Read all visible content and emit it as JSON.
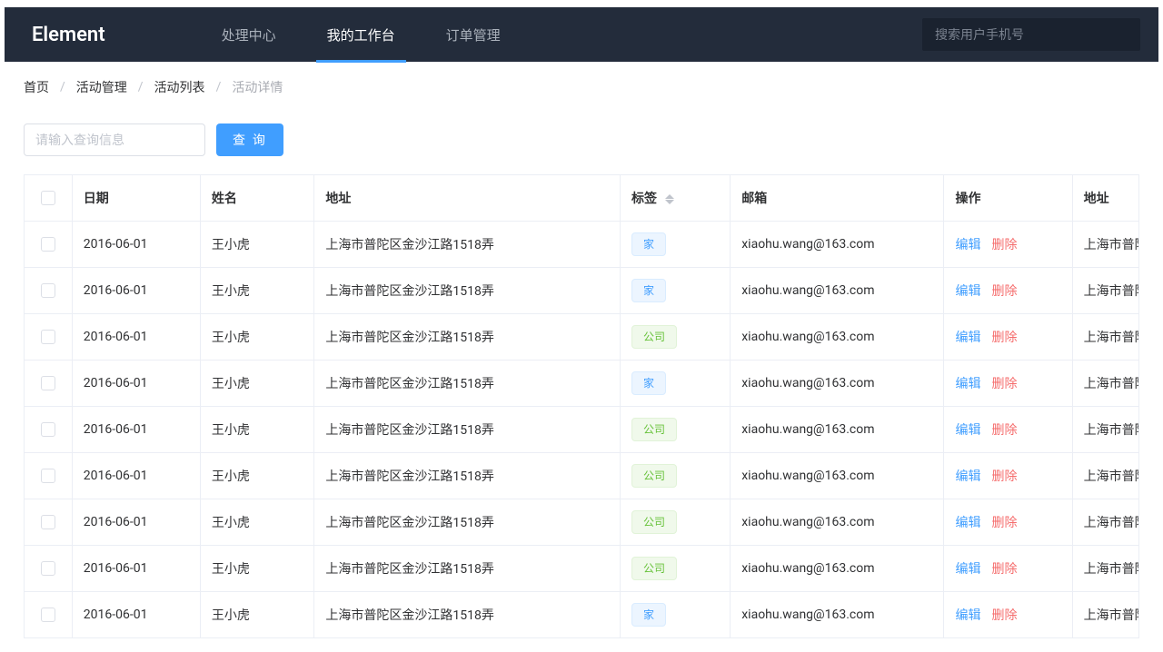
{
  "header": {
    "brand": "Element",
    "nav": [
      {
        "label": "处理中心",
        "active": false
      },
      {
        "label": "我的工作台",
        "active": true
      },
      {
        "label": "订单管理",
        "active": false
      }
    ],
    "search_placeholder": "搜索用户手机号"
  },
  "breadcrumb": {
    "items": [
      "首页",
      "活动管理",
      "活动列表"
    ],
    "current": "活动详情"
  },
  "toolbar": {
    "query_placeholder": "请输入查询信息",
    "query_btn": "查 询"
  },
  "table": {
    "columns": {
      "date": "日期",
      "name": "姓名",
      "address": "地址",
      "tag": "标签",
      "email": "邮箱",
      "operation": "操作",
      "address2": "地址"
    },
    "op_labels": {
      "edit": "编辑",
      "delete": "删除"
    },
    "tag_labels": {
      "home": "家",
      "company": "公司"
    },
    "rows": [
      {
        "date": "2016-06-01",
        "name": "王小虎",
        "address": "上海市普陀区金沙江路1518弄",
        "tag": "home",
        "email": "xiaohu.wang@163.com",
        "address2": "上海市普陀区"
      },
      {
        "date": "2016-06-01",
        "name": "王小虎",
        "address": "上海市普陀区金沙江路1518弄",
        "tag": "home",
        "email": "xiaohu.wang@163.com",
        "address2": "上海市普陀区"
      },
      {
        "date": "2016-06-01",
        "name": "王小虎",
        "address": "上海市普陀区金沙江路1518弄",
        "tag": "company",
        "email": "xiaohu.wang@163.com",
        "address2": "上海市普陀区"
      },
      {
        "date": "2016-06-01",
        "name": "王小虎",
        "address": "上海市普陀区金沙江路1518弄",
        "tag": "home",
        "email": "xiaohu.wang@163.com",
        "address2": "上海市普陀区"
      },
      {
        "date": "2016-06-01",
        "name": "王小虎",
        "address": "上海市普陀区金沙江路1518弄",
        "tag": "company",
        "email": "xiaohu.wang@163.com",
        "address2": "上海市普陀区"
      },
      {
        "date": "2016-06-01",
        "name": "王小虎",
        "address": "上海市普陀区金沙江路1518弄",
        "tag": "company",
        "email": "xiaohu.wang@163.com",
        "address2": "上海市普陀区"
      },
      {
        "date": "2016-06-01",
        "name": "王小虎",
        "address": "上海市普陀区金沙江路1518弄",
        "tag": "company",
        "email": "xiaohu.wang@163.com",
        "address2": "上海市普陀区"
      },
      {
        "date": "2016-06-01",
        "name": "王小虎",
        "address": "上海市普陀区金沙江路1518弄",
        "tag": "company",
        "email": "xiaohu.wang@163.com",
        "address2": "上海市普陀区"
      },
      {
        "date": "2016-06-01",
        "name": "王小虎",
        "address": "上海市普陀区金沙江路1518弄",
        "tag": "home",
        "email": "xiaohu.wang@163.com",
        "address2": "上海市普陀区"
      }
    ]
  }
}
